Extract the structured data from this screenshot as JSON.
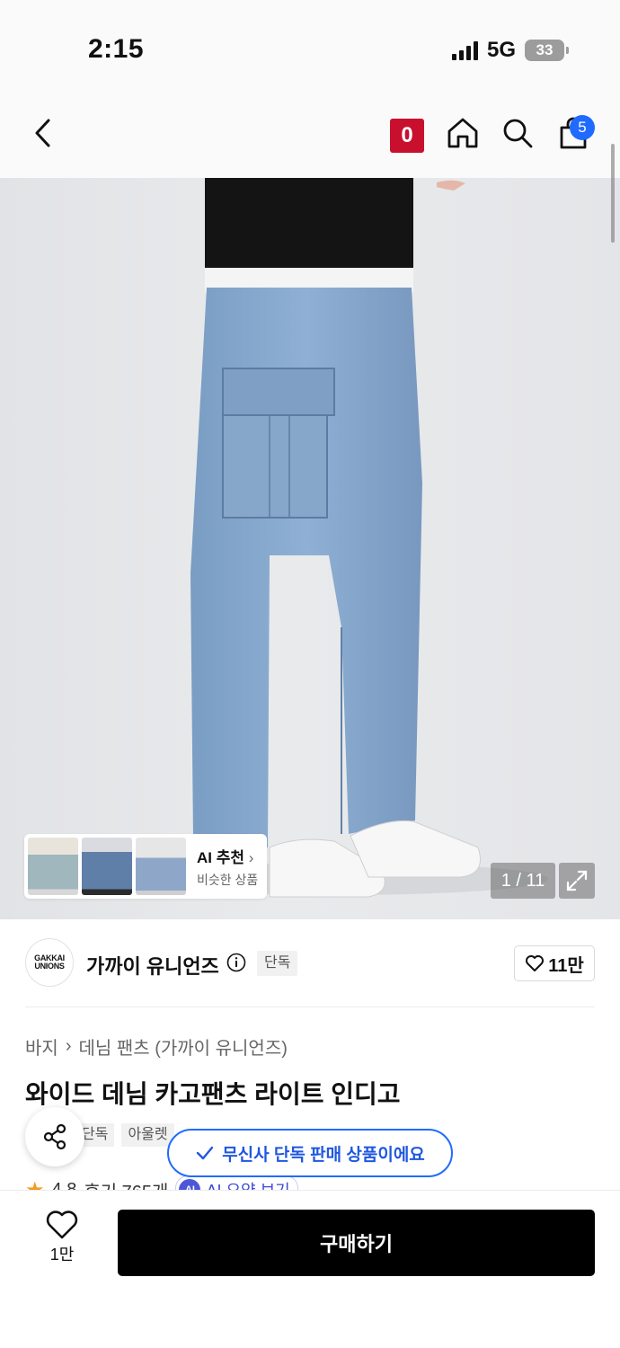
{
  "status_bar": {
    "time": "2:15",
    "network": "5G",
    "battery": "33"
  },
  "header": {
    "icons": [
      "back-icon",
      "musinsa-zero-badge",
      "home-icon",
      "search-icon",
      "cart-icon"
    ],
    "zero_badge": "0",
    "cart_count": "5"
  },
  "gallery": {
    "counter": "1 / 11",
    "ai_recommend": {
      "title": "AI 추천",
      "subtitle": "비슷한 상품"
    }
  },
  "brand": {
    "logo_line1": "GAKKAI",
    "logo_line2": "UNIONS",
    "name": "가까이 유니언즈",
    "tag": "단독",
    "likes": "11만"
  },
  "product": {
    "breadcrumb": [
      "바지",
      "데님 팬츠 (가까이 유니언즈)"
    ],
    "title": "와이드 데님 카고팬츠 라이트 인디고",
    "tags": [
      "단독",
      "아울렛"
    ],
    "rating": "4.8",
    "reviews": "후기 765개",
    "ai_chip": "AI",
    "ai_summary": "AI 요약 보기"
  },
  "toast": {
    "text": "무신사 단독 판매 상품이에요"
  },
  "bottom_bar": {
    "wish_count": "1만",
    "buy_label": "구매하기"
  },
  "colors": {
    "accent_blue": "#1f6bff",
    "zero_red": "#c8102e",
    "buy_black": "#000000"
  }
}
